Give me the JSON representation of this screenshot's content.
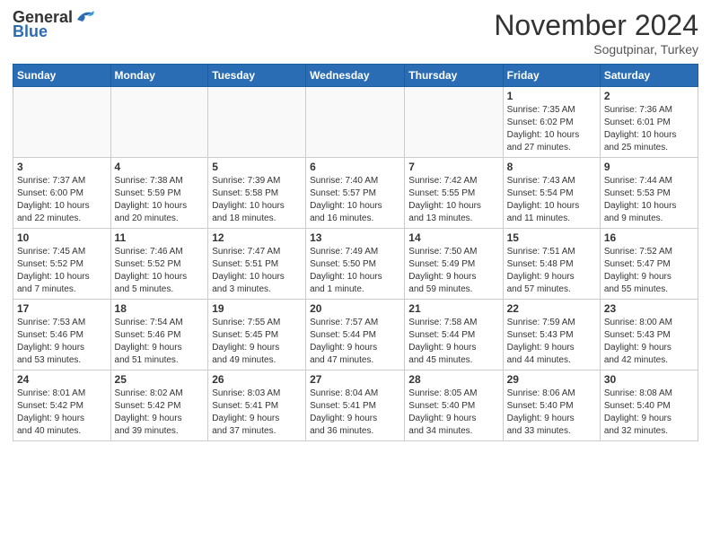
{
  "header": {
    "logo_general": "General",
    "logo_blue": "Blue",
    "month_year": "November 2024",
    "location": "Sogutpinar, Turkey"
  },
  "weekdays": [
    "Sunday",
    "Monday",
    "Tuesday",
    "Wednesday",
    "Thursday",
    "Friday",
    "Saturday"
  ],
  "weeks": [
    [
      {
        "day": "",
        "info": ""
      },
      {
        "day": "",
        "info": ""
      },
      {
        "day": "",
        "info": ""
      },
      {
        "day": "",
        "info": ""
      },
      {
        "day": "",
        "info": ""
      },
      {
        "day": "1",
        "info": "Sunrise: 7:35 AM\nSunset: 6:02 PM\nDaylight: 10 hours\nand 27 minutes."
      },
      {
        "day": "2",
        "info": "Sunrise: 7:36 AM\nSunset: 6:01 PM\nDaylight: 10 hours\nand 25 minutes."
      }
    ],
    [
      {
        "day": "3",
        "info": "Sunrise: 7:37 AM\nSunset: 6:00 PM\nDaylight: 10 hours\nand 22 minutes."
      },
      {
        "day": "4",
        "info": "Sunrise: 7:38 AM\nSunset: 5:59 PM\nDaylight: 10 hours\nand 20 minutes."
      },
      {
        "day": "5",
        "info": "Sunrise: 7:39 AM\nSunset: 5:58 PM\nDaylight: 10 hours\nand 18 minutes."
      },
      {
        "day": "6",
        "info": "Sunrise: 7:40 AM\nSunset: 5:57 PM\nDaylight: 10 hours\nand 16 minutes."
      },
      {
        "day": "7",
        "info": "Sunrise: 7:42 AM\nSunset: 5:55 PM\nDaylight: 10 hours\nand 13 minutes."
      },
      {
        "day": "8",
        "info": "Sunrise: 7:43 AM\nSunset: 5:54 PM\nDaylight: 10 hours\nand 11 minutes."
      },
      {
        "day": "9",
        "info": "Sunrise: 7:44 AM\nSunset: 5:53 PM\nDaylight: 10 hours\nand 9 minutes."
      }
    ],
    [
      {
        "day": "10",
        "info": "Sunrise: 7:45 AM\nSunset: 5:52 PM\nDaylight: 10 hours\nand 7 minutes."
      },
      {
        "day": "11",
        "info": "Sunrise: 7:46 AM\nSunset: 5:52 PM\nDaylight: 10 hours\nand 5 minutes."
      },
      {
        "day": "12",
        "info": "Sunrise: 7:47 AM\nSunset: 5:51 PM\nDaylight: 10 hours\nand 3 minutes."
      },
      {
        "day": "13",
        "info": "Sunrise: 7:49 AM\nSunset: 5:50 PM\nDaylight: 10 hours\nand 1 minute."
      },
      {
        "day": "14",
        "info": "Sunrise: 7:50 AM\nSunset: 5:49 PM\nDaylight: 9 hours\nand 59 minutes."
      },
      {
        "day": "15",
        "info": "Sunrise: 7:51 AM\nSunset: 5:48 PM\nDaylight: 9 hours\nand 57 minutes."
      },
      {
        "day": "16",
        "info": "Sunrise: 7:52 AM\nSunset: 5:47 PM\nDaylight: 9 hours\nand 55 minutes."
      }
    ],
    [
      {
        "day": "17",
        "info": "Sunrise: 7:53 AM\nSunset: 5:46 PM\nDaylight: 9 hours\nand 53 minutes."
      },
      {
        "day": "18",
        "info": "Sunrise: 7:54 AM\nSunset: 5:46 PM\nDaylight: 9 hours\nand 51 minutes."
      },
      {
        "day": "19",
        "info": "Sunrise: 7:55 AM\nSunset: 5:45 PM\nDaylight: 9 hours\nand 49 minutes."
      },
      {
        "day": "20",
        "info": "Sunrise: 7:57 AM\nSunset: 5:44 PM\nDaylight: 9 hours\nand 47 minutes."
      },
      {
        "day": "21",
        "info": "Sunrise: 7:58 AM\nSunset: 5:44 PM\nDaylight: 9 hours\nand 45 minutes."
      },
      {
        "day": "22",
        "info": "Sunrise: 7:59 AM\nSunset: 5:43 PM\nDaylight: 9 hours\nand 44 minutes."
      },
      {
        "day": "23",
        "info": "Sunrise: 8:00 AM\nSunset: 5:43 PM\nDaylight: 9 hours\nand 42 minutes."
      }
    ],
    [
      {
        "day": "24",
        "info": "Sunrise: 8:01 AM\nSunset: 5:42 PM\nDaylight: 9 hours\nand 40 minutes."
      },
      {
        "day": "25",
        "info": "Sunrise: 8:02 AM\nSunset: 5:42 PM\nDaylight: 9 hours\nand 39 minutes."
      },
      {
        "day": "26",
        "info": "Sunrise: 8:03 AM\nSunset: 5:41 PM\nDaylight: 9 hours\nand 37 minutes."
      },
      {
        "day": "27",
        "info": "Sunrise: 8:04 AM\nSunset: 5:41 PM\nDaylight: 9 hours\nand 36 minutes."
      },
      {
        "day": "28",
        "info": "Sunrise: 8:05 AM\nSunset: 5:40 PM\nDaylight: 9 hours\nand 34 minutes."
      },
      {
        "day": "29",
        "info": "Sunrise: 8:06 AM\nSunset: 5:40 PM\nDaylight: 9 hours\nand 33 minutes."
      },
      {
        "day": "30",
        "info": "Sunrise: 8:08 AM\nSunset: 5:40 PM\nDaylight: 9 hours\nand 32 minutes."
      }
    ]
  ]
}
